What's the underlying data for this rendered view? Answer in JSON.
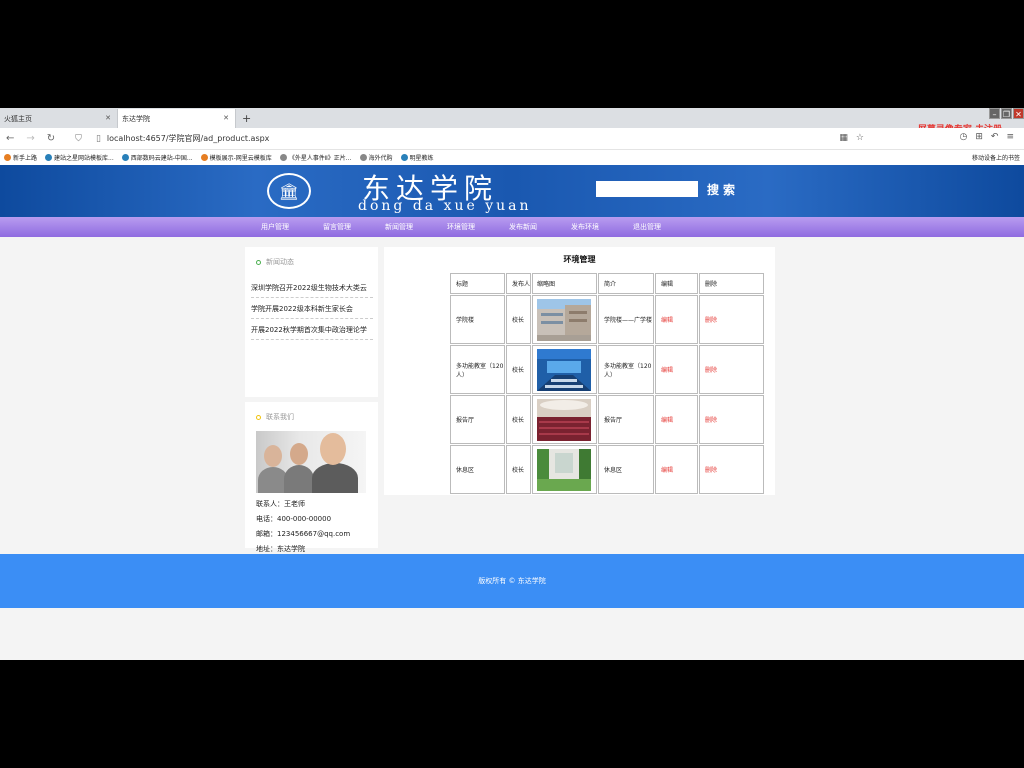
{
  "browser": {
    "tabs": [
      {
        "label": "火狐主页"
      },
      {
        "label": "东达学院"
      }
    ],
    "new_tab": "+",
    "url": "localhost:4657/学院官网/ad_product.aspx",
    "recorder_text": "屏幕录像专家 未注册",
    "bookmarks": [
      "新手上路",
      "建站之星网站模板库...",
      "西部数码云建站-中国...",
      "模板展示-网里云模板库",
      "《外星人事件Ⅱ》正片...",
      "海外代购",
      "明星教练"
    ],
    "bookmarks_right": "移动设备上的书签"
  },
  "site": {
    "title": "东达学院",
    "subtitle": "dong da xue yuan",
    "search_label": "搜索",
    "search_placeholder": ""
  },
  "nav": {
    "items": [
      {
        "label": "用户管理"
      },
      {
        "label": "留言管理"
      },
      {
        "label": "新闻管理"
      },
      {
        "label": "环境管理"
      },
      {
        "label": "发布新闻"
      },
      {
        "label": "发布环境"
      },
      {
        "label": "退出管理"
      }
    ]
  },
  "sidebar": {
    "news_title": "新闻动态",
    "news": [
      {
        "label": "深圳学院召开2022级生物技术大类云"
      },
      {
        "label": "学院开展2022级本科新生家长会"
      },
      {
        "label": "开展2022秋学期首次集中政治理论学"
      }
    ],
    "contact_title": "联系我们",
    "contact": {
      "person": "联系人：王老师",
      "phone": "电话：400-000-00000",
      "email": "邮箱：123456667@qq.com",
      "address": "地址：东达学院"
    }
  },
  "main": {
    "title": "环境管理",
    "headers": [
      "标题",
      "发布人",
      "缩略图",
      "简介",
      "编辑",
      "删除"
    ],
    "rows": [
      {
        "title": "学院楼",
        "author": "校长",
        "intro": "学院楼——广学楼",
        "edit": "编辑",
        "delete": "删除"
      },
      {
        "title": "多功能教室（120人）",
        "author": "校长",
        "intro": "多功能教室（120人）",
        "edit": "编辑",
        "delete": "删除"
      },
      {
        "title": "报告厅",
        "author": "校长",
        "intro": "报告厅",
        "edit": "编辑",
        "delete": "删除"
      },
      {
        "title": "休息区",
        "author": "校长",
        "intro": "休息区",
        "edit": "编辑",
        "delete": "删除"
      }
    ]
  },
  "footer": {
    "text": "版权所有 © 东达学院"
  }
}
